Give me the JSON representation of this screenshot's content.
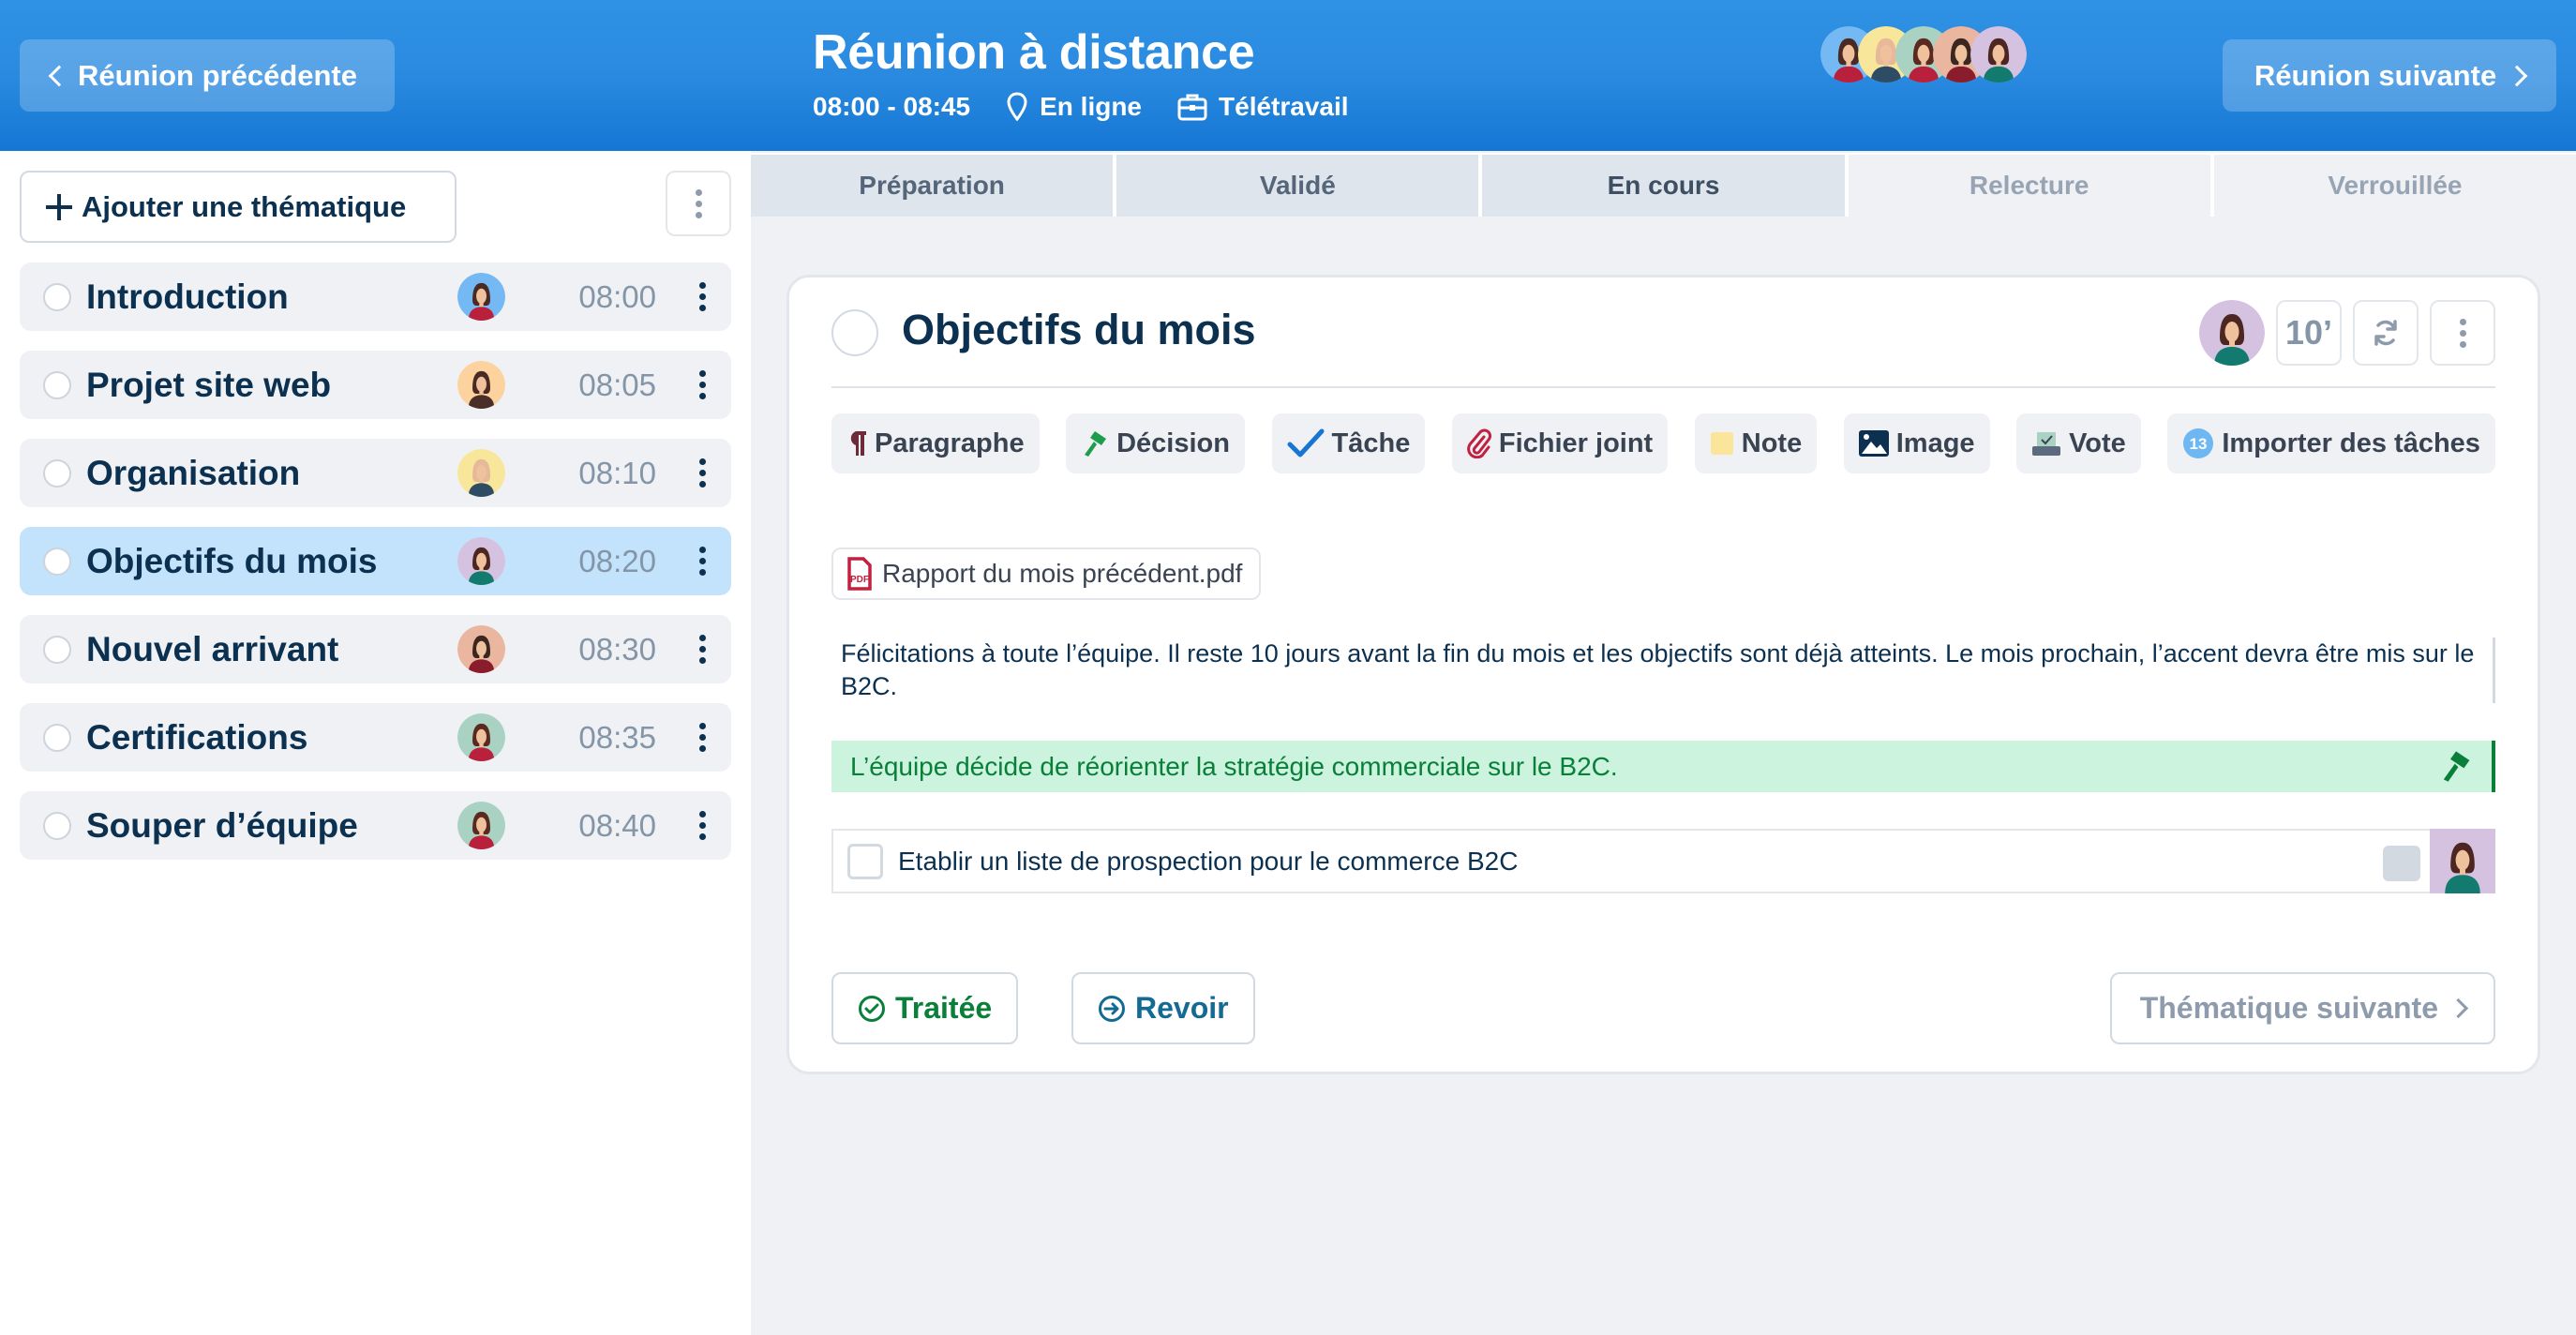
{
  "header": {
    "prev_meeting_label": "Réunion précédente",
    "next_meeting_label": "Réunion suivante",
    "title": "Réunion à distance",
    "time_range": "08:00 - 08:45",
    "location": "En ligne",
    "category": "Télétravail",
    "participants": [
      {
        "bg": "#74b9f3",
        "hair": "#4a2a22",
        "shirt": "#b9203c"
      },
      {
        "bg": "#f8e69a",
        "hair": "#e6b99a",
        "shirt": "#2e4c63"
      },
      {
        "bg": "#a9d2c2",
        "hair": "#5a2a20",
        "shirt": "#b9203c"
      },
      {
        "bg": "#eab6a0",
        "hair": "#3b2620",
        "shirt": "#8a1d2b"
      },
      {
        "bg": "#d5c2e0",
        "hair": "#4d2622",
        "shirt": "#137a6f"
      }
    ]
  },
  "sidebar": {
    "add_topic_label": "Ajouter une thématique",
    "topics": [
      {
        "name": "Introduction",
        "time": "08:00",
        "active": false,
        "avatar": {
          "bg": "#74b9f3",
          "hair": "#4a2a22",
          "shirt": "#b9203c"
        }
      },
      {
        "name": "Projet site web",
        "time": "08:05",
        "active": false,
        "avatar": {
          "bg": "#fcd29e",
          "hair": "#4a2a22",
          "shirt": "#4a2e28"
        }
      },
      {
        "name": "Organisation",
        "time": "08:10",
        "active": false,
        "avatar": {
          "bg": "#f8e69a",
          "hair": "#e6b99a",
          "shirt": "#2e4c63"
        }
      },
      {
        "name": "Objectifs du mois",
        "time": "08:20",
        "active": true,
        "avatar": {
          "bg": "#d5c2e0",
          "hair": "#4d2622",
          "shirt": "#137a6f"
        }
      },
      {
        "name": "Nouvel arrivant",
        "time": "08:30",
        "active": false,
        "avatar": {
          "bg": "#eab6a0",
          "hair": "#3b2620",
          "shirt": "#8a1d2b"
        }
      },
      {
        "name": "Certifications",
        "time": "08:35",
        "active": false,
        "avatar": {
          "bg": "#a9d2c2",
          "hair": "#5a2a20",
          "shirt": "#b9203c"
        }
      },
      {
        "name": "Souper d’équipe",
        "time": "08:40",
        "active": false,
        "avatar": {
          "bg": "#a9d2c2",
          "hair": "#5a2a20",
          "shirt": "#b9203c"
        }
      }
    ]
  },
  "tabs": [
    {
      "label": "Préparation",
      "state": "done"
    },
    {
      "label": "Validé",
      "state": "done"
    },
    {
      "label": "En cours",
      "state": "current"
    },
    {
      "label": "Relecture",
      "state": "future"
    },
    {
      "label": "Verrouillée",
      "state": "future"
    }
  ],
  "topic": {
    "title": "Objectifs du mois",
    "duration": "10’",
    "toolbar": {
      "paragraph": "Paragraphe",
      "decision": "Décision",
      "task": "Tâche",
      "attachment": "Fichier joint",
      "note": "Note",
      "image": "Image",
      "vote": "Vote",
      "import_tasks": "Importer des tâches",
      "import_count": "13"
    },
    "attachment_name": "Rapport du mois précédent.pdf",
    "paragraph_text": "Félicitations à toute l’équipe. Il reste 10 jours avant la fin du mois et les objectifs sont déjà atteints. Le mois prochain, l’accent devra être mis sur le B2C.",
    "decision_text": "L’équipe décide de réorienter la stratégie commerciale sur le B2C.",
    "task_text": "Etablir un liste de prospection pour le commerce B2C",
    "task_done": false,
    "actions": {
      "done_label": "Traitée",
      "review_label": "Revoir",
      "next_topic_label": "Thématique suivante"
    }
  },
  "colors": {
    "header_blue": "#2a8ae0",
    "navy": "#0c3150",
    "decision_green": "#0a7f3a",
    "decision_bg": "#cbf3dd",
    "review_blue": "#136b94",
    "active_row": "#c3e2fb"
  }
}
